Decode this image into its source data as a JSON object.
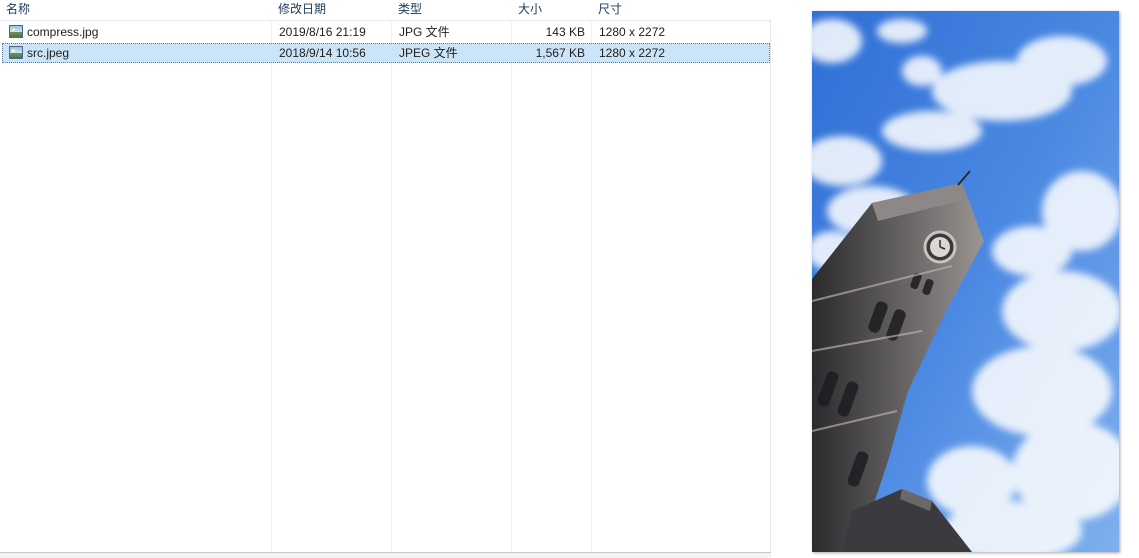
{
  "columns": {
    "name": "名称",
    "date": "修改日期",
    "type": "类型",
    "size": "大小",
    "dims": "尺寸"
  },
  "files": [
    {
      "name": "compress.jpg",
      "date": "2019/8/16 21:19",
      "type": "JPG 文件",
      "size": "143 KB",
      "dims": "1280 x 2272",
      "selected": false
    },
    {
      "name": "src.jpeg",
      "date": "2018/9/14 10:56",
      "type": "JPEG 文件",
      "size": "1,567 KB",
      "dims": "1280 x 2272",
      "selected": true
    }
  ],
  "icons": {
    "file": "image-file-icon"
  },
  "colors": {
    "selection": "#cce4f7",
    "sky": "#3a78d8"
  }
}
